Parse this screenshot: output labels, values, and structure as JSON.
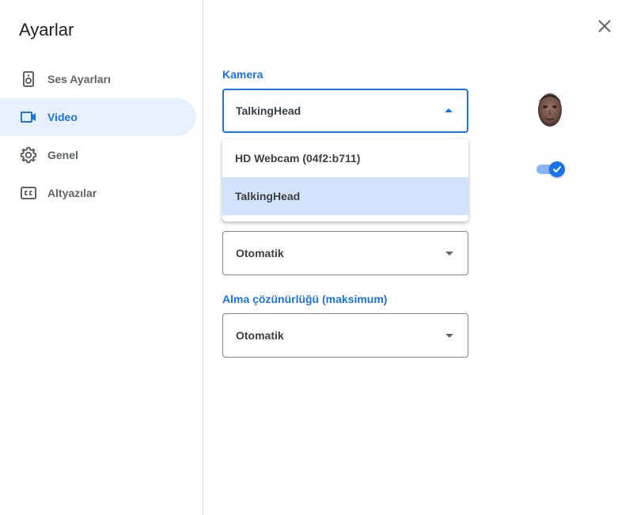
{
  "dialog": {
    "title": "Ayarlar",
    "close_icon": "close-icon"
  },
  "sidebar": {
    "items": [
      {
        "label": "Ses Ayarları",
        "icon": "speaker-icon",
        "active": false
      },
      {
        "label": "Video",
        "icon": "videocam-icon",
        "active": true
      },
      {
        "label": "Genel",
        "icon": "gear-icon",
        "active": false
      },
      {
        "label": "Altyazılar",
        "icon": "closed-captions-icon",
        "active": false
      }
    ]
  },
  "video": {
    "camera": {
      "label": "Kamera",
      "value": "TalkingHead",
      "options": [
        "HD Webcam (04f2:b711)",
        "TalkingHead"
      ],
      "selected_index": 1
    },
    "send_resolution": {
      "value": "Otomatik"
    },
    "receive_resolution": {
      "label": "Alma çözünürlüğü (maksimum)",
      "value": "Otomatik"
    },
    "toggle_on": true
  },
  "colors": {
    "accent": "#1a73e8",
    "active_bg": "#e8f0fe",
    "selected_option_bg": "#d2e3fc"
  }
}
